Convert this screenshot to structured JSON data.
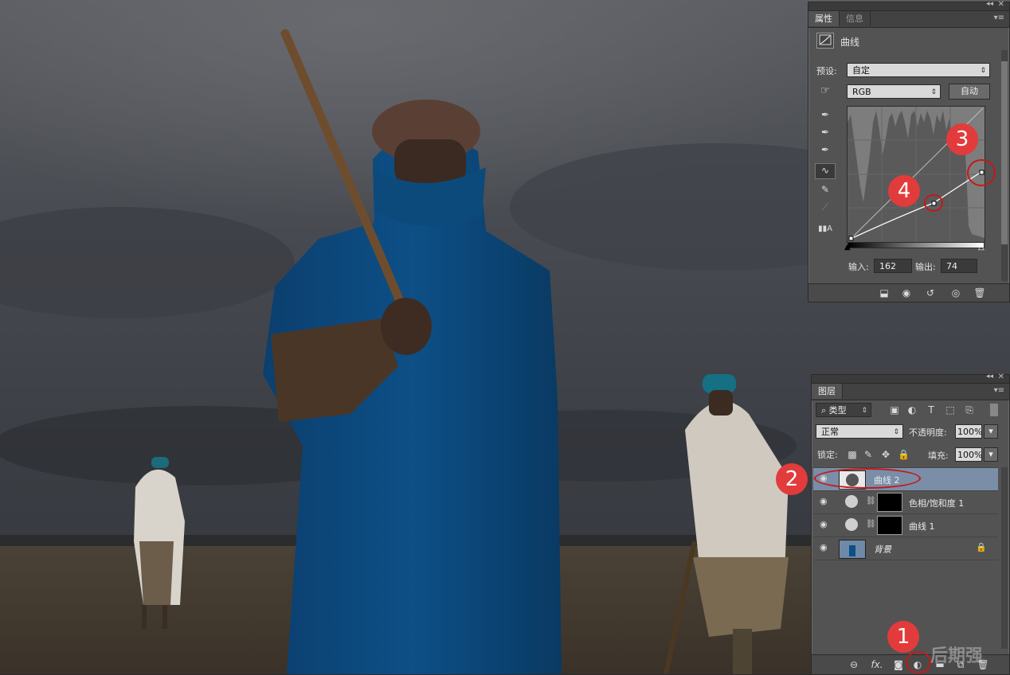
{
  "properties_panel": {
    "tabs": [
      "属性",
      "信息"
    ],
    "title": "曲线",
    "preset_label": "预设:",
    "preset_value": "自定",
    "channel_value": "RGB",
    "auto_button": "自动",
    "input_label": "输入:",
    "input_value": "162",
    "output_label": "输出:",
    "output_value": "74"
  },
  "layers_panel": {
    "tab": "图层",
    "filter_kind": "类型",
    "blend_mode": "正常",
    "opacity_label": "不透明度:",
    "opacity_value": "100%",
    "lock_label": "锁定:",
    "fill_label": "填充:",
    "fill_value": "100%",
    "layers": [
      {
        "name": "曲线 2",
        "selected": true
      },
      {
        "name": "色相/饱和度 1",
        "selected": false
      },
      {
        "name": "曲线 1",
        "selected": false
      },
      {
        "name": "背景",
        "selected": false
      }
    ],
    "footer_fx": "fx."
  },
  "annotations": [
    "1",
    "2",
    "3",
    "4"
  ],
  "watermark": "后期强",
  "colors": {
    "accent_red": "#e23b3b",
    "selection": "#7a8ea8",
    "panel": "#535353"
  }
}
